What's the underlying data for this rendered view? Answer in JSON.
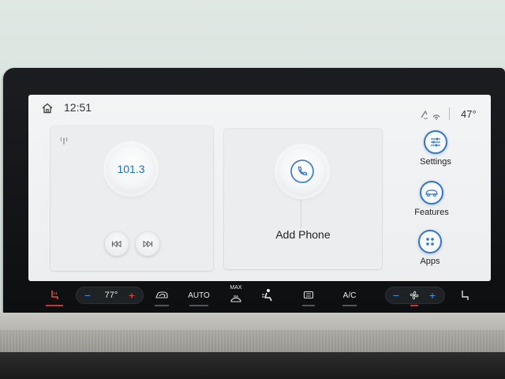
{
  "status": {
    "time": "12:51",
    "outside_temp": "47°"
  },
  "radio": {
    "station": "101.3"
  },
  "phone": {
    "label": "Add Phone"
  },
  "side_menu": {
    "items": [
      {
        "label": "Settings",
        "icon": "settings-sliders-icon"
      },
      {
        "label": "Features",
        "icon": "car-icon"
      },
      {
        "label": "Apps",
        "icon": "apps-grid-icon"
      }
    ]
  },
  "climate": {
    "left_temp": "77°",
    "auto_label": "AUTO",
    "max_label": "MAX",
    "ac_label": "A/C"
  },
  "colors": {
    "accent": "#2f76d2",
    "station_text": "#1a6fd1",
    "heat_red": "#e84a4a",
    "cool_blue": "#4e8fe8"
  }
}
